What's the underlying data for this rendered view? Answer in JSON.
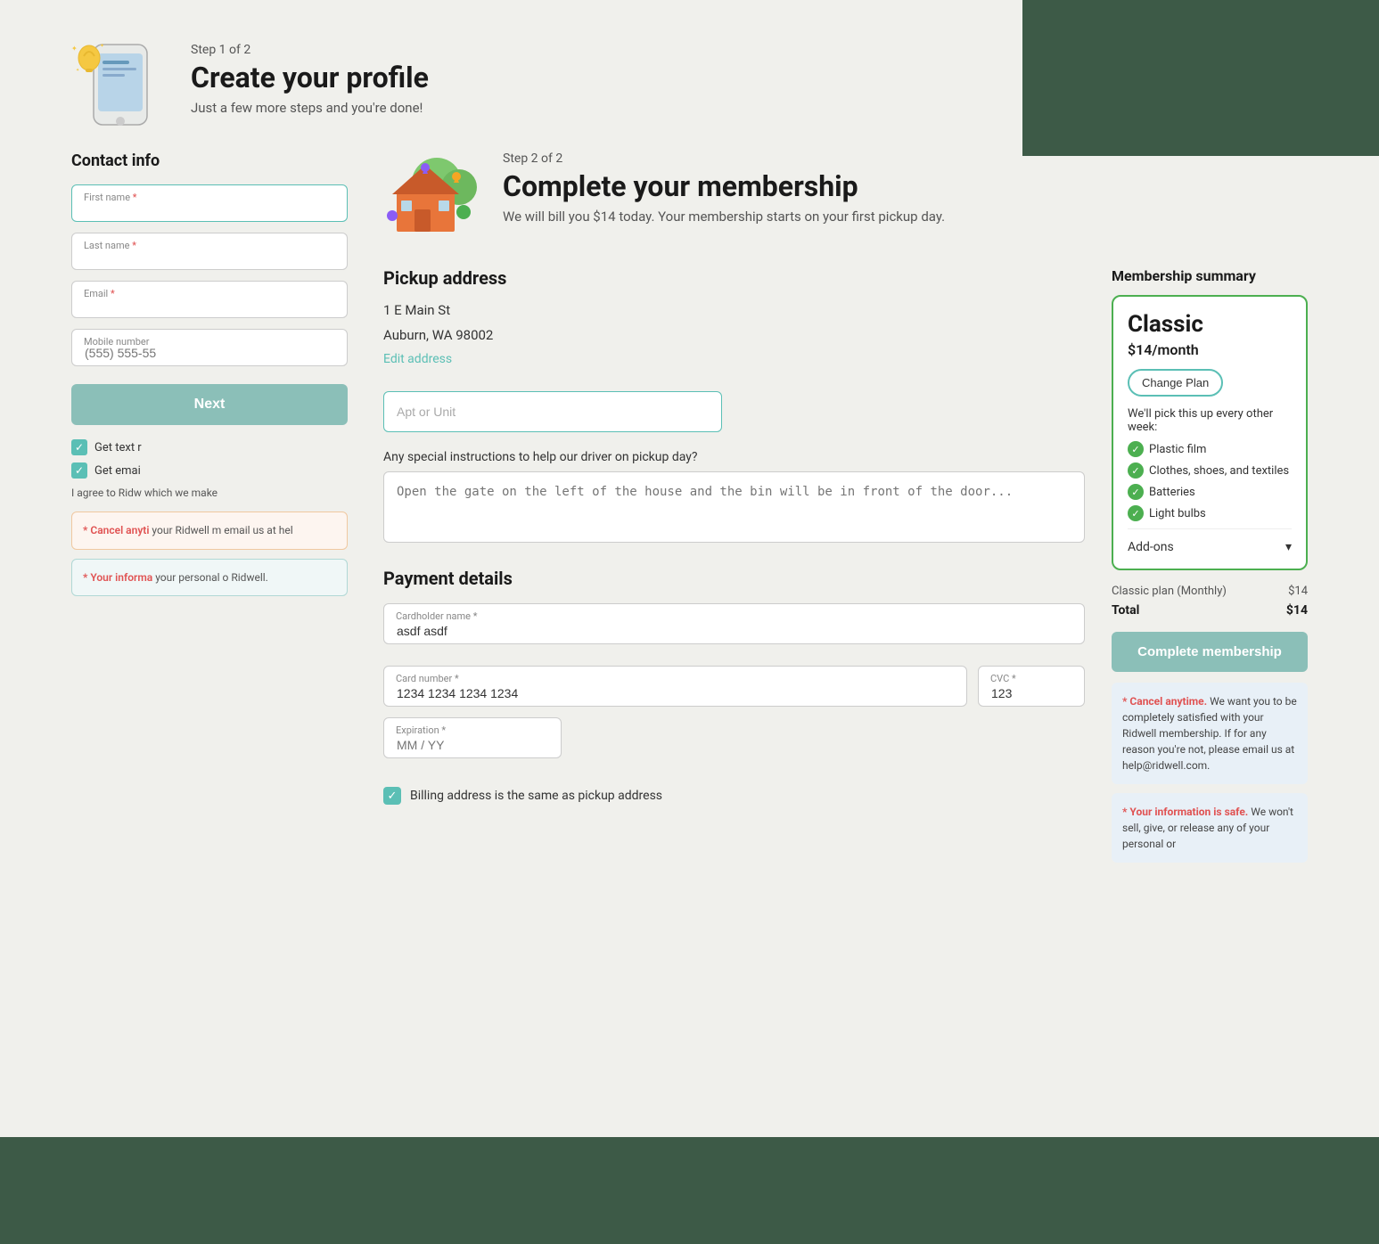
{
  "step1": {
    "step_label": "Step 1 of 2",
    "title": "Create your profile",
    "subtitle": "Just a few more steps and you're done!",
    "contact_section": "Contact info",
    "fields": {
      "first_name_label": "First name",
      "first_name_required": "*",
      "last_name_label": "Last name",
      "last_name_required": "*",
      "email_label": "Email",
      "email_required": "*",
      "mobile_label": "Mobile number",
      "mobile_placeholder": "(555) 555-55"
    },
    "next_button": "Next",
    "checkboxes": {
      "text_label": "Get text r",
      "email_label": "Get emai"
    },
    "agree_text": "I agree to Ridw which we make",
    "cancel_notice": {
      "title": "* Cancel anyti",
      "body": "your Ridwell m email us at hel"
    },
    "info_notice": {
      "title": "* Your informa",
      "body": "your personal o Ridwell."
    }
  },
  "step2": {
    "step_label": "Step 2 of 2",
    "title": "Complete your membership",
    "subtitle": "We will bill you $14 today. Your membership starts on your first pickup day.",
    "pickup_address": {
      "section_title": "Pickup address",
      "street": "1 E Main St",
      "city_state_zip": "Auburn, WA 98002",
      "edit_link": "Edit address",
      "apt_placeholder": "Apt or Unit",
      "instructions_label": "Any special instructions to help our driver on pickup day?",
      "instructions_placeholder": "Open the gate on the left of the house and the bin will be in front of the door..."
    },
    "payment": {
      "section_title": "Payment details",
      "cardholder_label": "Cardholder name *",
      "cardholder_value": "asdf asdf",
      "card_number_label": "Card number *",
      "card_number_value": "1234 1234 1234 1234",
      "cvc_label": "CVC *",
      "cvc_value": "123",
      "expiration_label": "Expiration *",
      "expiration_placeholder": "MM / YY",
      "billing_checkbox": "Billing address is the same as pickup address"
    }
  },
  "membership": {
    "title": "Membership summary",
    "plan_name": "Classic",
    "plan_price": "$14/month",
    "change_plan_label": "Change Plan",
    "pickup_frequency": "We'll pick this up every other week:",
    "items": [
      "Plastic film",
      "Clothes, shoes, and textiles",
      "Batteries",
      "Light bulbs"
    ],
    "addons_label": "Add-ons",
    "pricing": {
      "classic_label": "Classic plan (Monthly)",
      "classic_price": "$14",
      "total_label": "Total",
      "total_price": "$14"
    },
    "complete_button": "Complete membership",
    "cancel_notice": {
      "highlight": "* Cancel anytime.",
      "body": "We want you to be completely satisfied with your Ridwell membership. If for any reason you're not, please email us at help@ridwell.com."
    },
    "safe_notice": {
      "highlight": "* Your information is safe.",
      "body": "We won't sell, give, or release any of your personal or"
    }
  },
  "icons": {
    "chevron_down": "▾",
    "check": "✓"
  }
}
